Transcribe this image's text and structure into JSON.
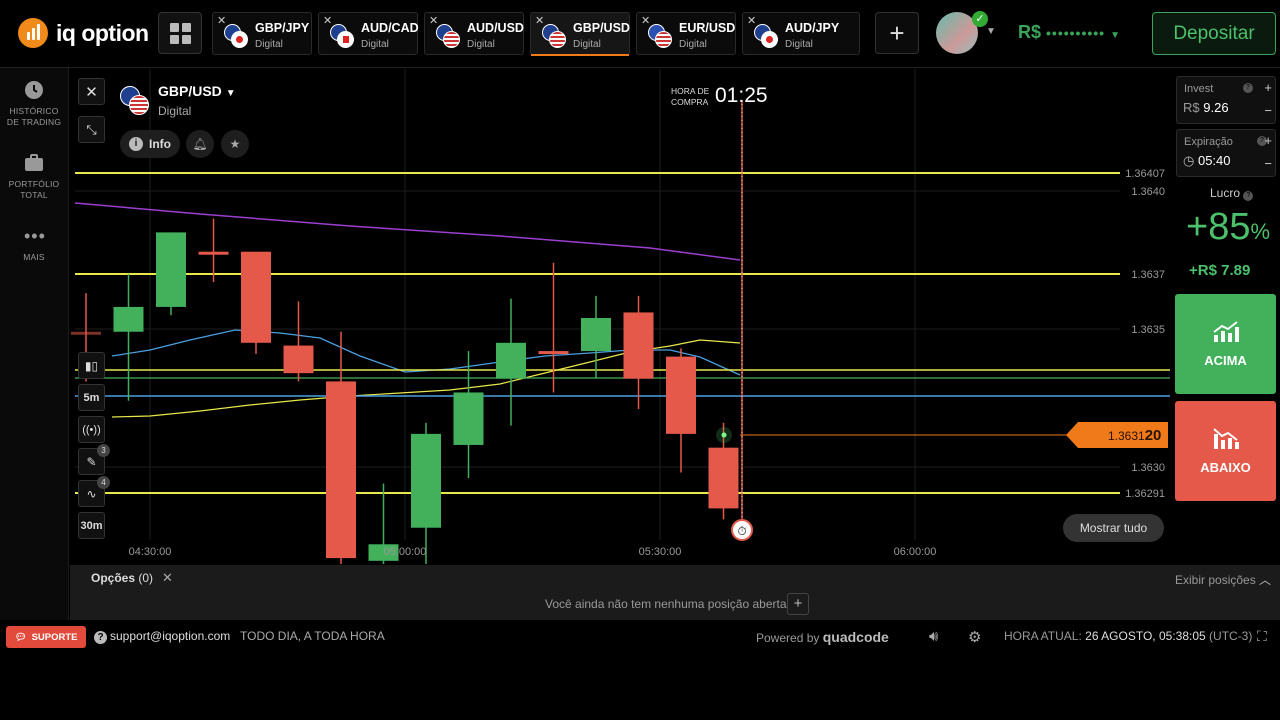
{
  "brand": {
    "name": "iq option",
    "color": "#f08a1a"
  },
  "tabs": [
    {
      "pair": "GBP/JPY",
      "type": "Digital",
      "active": false
    },
    {
      "pair": "AUD/CAD",
      "type": "Digital",
      "active": false
    },
    {
      "pair": "AUD/USD",
      "type": "Digital",
      "active": false
    },
    {
      "pair": "GBP/USD",
      "type": "Digital",
      "active": true
    },
    {
      "pair": "EUR/USD",
      "type": "Digital",
      "active": false
    },
    {
      "pair": "AUD/JPY",
      "type": "Digital",
      "active": false
    }
  ],
  "account": {
    "currency": "R$",
    "masked_balance": "••••••••••",
    "deposit_label": "Depositar"
  },
  "sidebar": {
    "items": [
      {
        "icon": "clock-icon",
        "label": "HISTÓRICO DE TRADING"
      },
      {
        "icon": "briefcase-icon",
        "label": "PORTFÓLIO TOTAL"
      },
      {
        "icon": "more-icon",
        "label": "MAIS"
      }
    ]
  },
  "asset": {
    "pair": "GBP/USD",
    "type": "Digital",
    "info_label": "Info"
  },
  "timer": {
    "label": "HORA DE COMPRA",
    "value": "01:25"
  },
  "tools": {
    "timeframe": "5m",
    "period": "30m",
    "drawings_badge": "3",
    "indicators_badge": "4"
  },
  "chart_data": {
    "type": "candlestick",
    "x_ticks": [
      "04:30:00",
      "05:00:00",
      "05:30:00",
      "06:00:00"
    ],
    "y_ticks": [
      "1.3640",
      "1.3637",
      "1.3635",
      "1.3630"
    ],
    "level_labels": [
      "1.36407",
      "1.36291"
    ],
    "current_price": {
      "main": "1.3631",
      "suffix": "20"
    },
    "candles": [
      {
        "o": 1.36349,
        "h": 1.36363,
        "l": 1.36331,
        "c": 1.36349,
        "dir": "down"
      },
      {
        "o": 1.36349,
        "h": 1.3637,
        "l": 1.36324,
        "c": 1.36358,
        "dir": "up"
      },
      {
        "o": 1.36358,
        "h": 1.36385,
        "l": 1.36355,
        "c": 1.36385,
        "dir": "up"
      },
      {
        "o": 1.36378,
        "h": 1.3639,
        "l": 1.36367,
        "c": 1.36378,
        "dir": "down"
      },
      {
        "o": 1.36378,
        "h": 1.36378,
        "l": 1.36341,
        "c": 1.36345,
        "dir": "down"
      },
      {
        "o": 1.36344,
        "h": 1.3636,
        "l": 1.36331,
        "c": 1.36334,
        "dir": "down"
      },
      {
        "o": 1.36331,
        "h": 1.36349,
        "l": 1.36252,
        "c": 1.36267,
        "dir": "down"
      },
      {
        "o": 1.36266,
        "h": 1.36294,
        "l": 1.36249,
        "c": 1.36272,
        "dir": "up"
      },
      {
        "o": 1.36278,
        "h": 1.36316,
        "l": 1.36246,
        "c": 1.36312,
        "dir": "up"
      },
      {
        "o": 1.36308,
        "h": 1.36342,
        "l": 1.36296,
        "c": 1.36327,
        "dir": "up"
      },
      {
        "o": 1.36332,
        "h": 1.36361,
        "l": 1.36315,
        "c": 1.36345,
        "dir": "up"
      },
      {
        "o": 1.36342,
        "h": 1.36374,
        "l": 1.36327,
        "c": 1.36342,
        "dir": "down"
      },
      {
        "o": 1.36342,
        "h": 1.36362,
        "l": 1.36332,
        "c": 1.36354,
        "dir": "up"
      },
      {
        "o": 1.36356,
        "h": 1.36362,
        "l": 1.36321,
        "c": 1.36332,
        "dir": "down"
      },
      {
        "o": 1.3634,
        "h": 1.36343,
        "l": 1.36298,
        "c": 1.36312,
        "dir": "down"
      },
      {
        "o": 1.36307,
        "h": 1.36316,
        "l": 1.36281,
        "c": 1.36285,
        "dir": "down"
      }
    ]
  },
  "colors": {
    "up": "#43b05c",
    "down": "#e5594b",
    "level": "#e8e84a",
    "purple": "#9b3fcf",
    "blue": "#4aa0e0",
    "expiry": "#e5594b"
  },
  "show_all_label": "Mostrar tudo",
  "trade_panel": {
    "invest_label": "Invest",
    "invest_currency": "R$",
    "invest_value": "9.26",
    "expiry_label": "Expiração",
    "expiry_value": "05:40",
    "profit_label": "Lucro",
    "profit_pct": "+85",
    "profit_amount": "+R$ 7.89",
    "up_label": "ACIMA",
    "down_label": "ABAIXO"
  },
  "positions": {
    "label": "Opções",
    "count": "(0)",
    "empty_text": "Você ainda não tem nenhuma posição aberta",
    "show_label": "Exibir posições"
  },
  "footer": {
    "support_label": "SUPORTE",
    "email": "support@iqoption.com",
    "hours": "TODO DIA, A TODA HORA",
    "powered": "Powered by",
    "vendor": "quadcode",
    "time_label": "HORA ATUAL:",
    "time_value": "26 AGOSTO, 05:38:05",
    "timezone": "(UTC-3)"
  }
}
